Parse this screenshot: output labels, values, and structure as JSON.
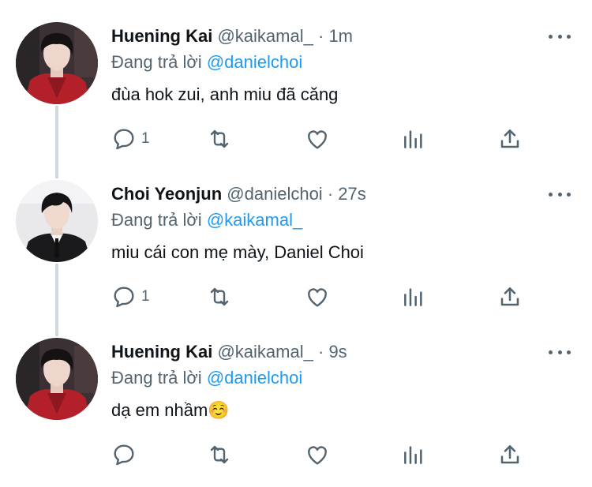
{
  "colors": {
    "accent": "#1d9bf0",
    "muted": "#536471",
    "text": "#0f1419",
    "thread_line": "#cfd9de"
  },
  "tweets": [
    {
      "name": "Huening Kai",
      "handle": "@kaikamal_",
      "dot": "·",
      "time": "1m",
      "replying_prefix": "Đang trả lời",
      "replying_to": "@danielchoi",
      "text": "đùa hok zui, anh miu đã căng",
      "reply_count": "1",
      "avatar": "avatar-red-jacket"
    },
    {
      "name": "Choi Yeonjun",
      "handle": "@danielchoi",
      "dot": "·",
      "time": "27s",
      "replying_prefix": "Đang trả lời",
      "replying_to": "@kaikamal_",
      "text": "miu cái con mẹ mày, Daniel Choi",
      "reply_count": "1",
      "avatar": "avatar-black-suit"
    },
    {
      "name": "Huening Kai",
      "handle": "@kaikamal_",
      "dot": "·",
      "time": "9s",
      "replying_prefix": "Đang trả lời",
      "replying_to": "@danielchoi",
      "text": "dạ em nhầm☺️",
      "reply_count": "",
      "avatar": "avatar-red-jacket"
    }
  ],
  "icons": {
    "reply": "reply-icon",
    "retweet": "retweet-icon",
    "like": "like-icon",
    "views": "views-icon",
    "share": "share-icon",
    "more": "more-icon"
  }
}
